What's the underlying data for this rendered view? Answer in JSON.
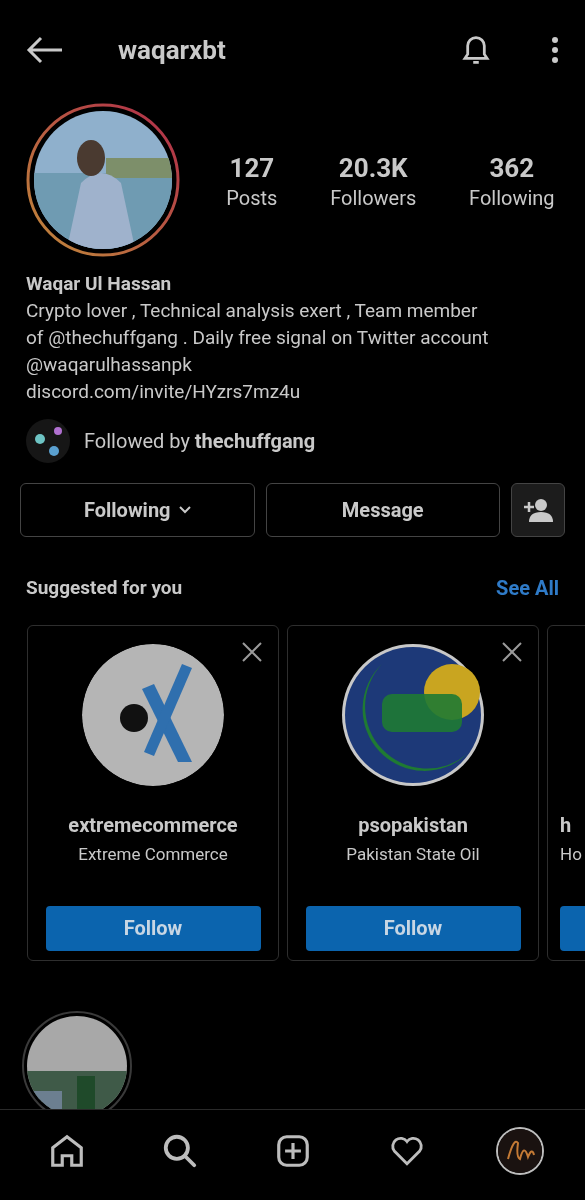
{
  "header": {
    "title": "waqarxbt"
  },
  "profile": {
    "stats": [
      {
        "value": "127",
        "label": "Posts"
      },
      {
        "value": "20.3K",
        "label": "Followers"
      },
      {
        "value": "362",
        "label": "Following"
      }
    ],
    "name": "Waqar Ul Hassan",
    "bio_lines": [
      "Crypto lover , Technical analysis exert ,  Team member",
      "of  @thechuffgang . Daily free signal on Twitter account",
      "@waqarulhassanpk"
    ],
    "link": "discord.com/invite/HYzrs7mz4u",
    "followed_by": "Followed by **thechuffgang**"
  },
  "actions": {
    "following": "Following",
    "message": "Message"
  },
  "suggested": {
    "title": "Suggested for you",
    "see_all": "See All",
    "cards": [
      {
        "username": "extremecommerce",
        "full_name": "Extreme Commerce",
        "button": "Follow"
      },
      {
        "username": "psopakistan",
        "full_name": "Pakistan State Oil",
        "button": "Follow"
      },
      {
        "username": "h",
        "full_name": "Ho"
      }
    ]
  },
  "nav": [
    {
      "kind": "home",
      "selected": false
    },
    {
      "kind": "search",
      "selected": false
    },
    {
      "kind": "add",
      "selected": false
    },
    {
      "kind": "heart",
      "selected": false
    },
    {
      "kind": "profile",
      "selected": true
    }
  ]
}
